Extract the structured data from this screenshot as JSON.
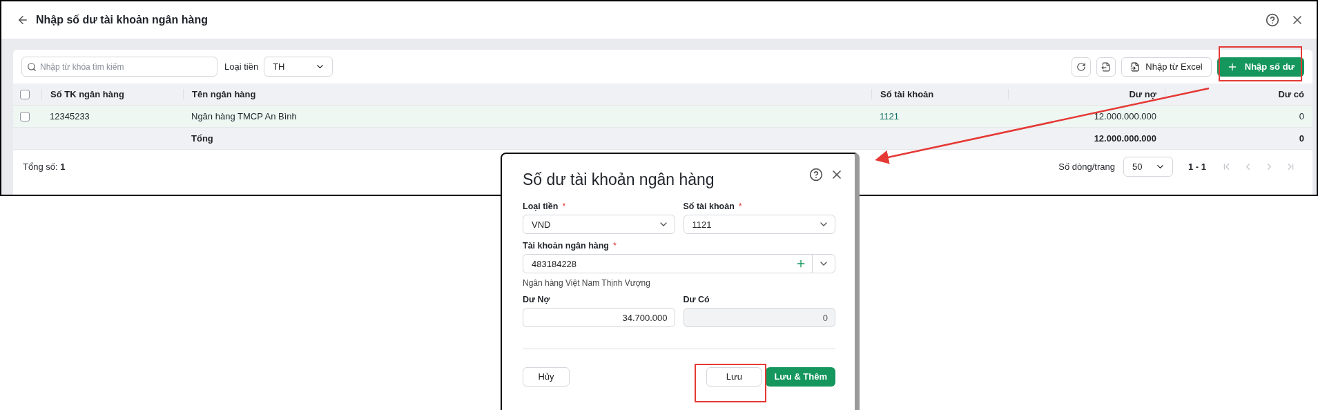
{
  "page": {
    "title": "Nhập số dư tài khoản ngân hàng"
  },
  "toolbar": {
    "search_placeholder": "Nhập từ khóa tìm kiếm",
    "currency_label": "Loại tiền",
    "currency_value": "TH",
    "import_label": "Nhập từ Excel",
    "add_label": "Nhập số dư"
  },
  "table": {
    "header_checked": false,
    "columns": [
      {
        "label": "Số TK ngân hàng",
        "kind": "text"
      },
      {
        "label": "Tên ngân hàng",
        "kind": "text"
      },
      {
        "label": "Số tài khoản",
        "kind": "link"
      },
      {
        "label": "Dư nợ",
        "kind": "amount"
      },
      {
        "label": "Dư có",
        "kind": "amount"
      }
    ],
    "rows": [
      {
        "checked": false,
        "cells": [
          "12345233",
          "Ngân hàng TMCP An Bình",
          "1121",
          "12.000.000.000",
          "0"
        ]
      }
    ],
    "total": {
      "label": "Tổng",
      "debit": "12.000.000.000",
      "credit": "0"
    }
  },
  "footer": {
    "count": "Tổng số: **1**",
    "page_size_label": "Số dòng/trang",
    "page_size": "50",
    "range": "1 - 1",
    "pager": [
      {
        "kind": "first",
        "disabled": true
      },
      {
        "kind": "prev",
        "disabled": true
      },
      {
        "kind": "next",
        "disabled": true
      },
      {
        "kind": "last",
        "disabled": true
      }
    ]
  },
  "dialog": {
    "title": "Số dư tài khoản ngân hàng",
    "fields": [
      {
        "kind": "select",
        "label": "Loại tiền",
        "required_mark": "*",
        "value": "VND",
        "wide": false
      },
      {
        "kind": "select",
        "label": "Số tài khoản",
        "required_mark": "*",
        "value": "1121",
        "wide": false
      },
      {
        "kind": "combo",
        "label": "Tài khoản ngân hàng",
        "required_mark": "*",
        "value": "483184228",
        "wide": true,
        "hint": "Ngân hàng Việt Nam Thịnh Vượng"
      },
      {
        "kind": "number",
        "label": "Dư Nợ",
        "value": "34.700.000",
        "wide": false,
        "disabled": false
      },
      {
        "kind": "number",
        "label": "Dư Có",
        "value": "0",
        "wide": false,
        "disabled": true
      }
    ],
    "cancel": "Hủy",
    "save": "Lưu",
    "save_add": "Lưu & Thêm"
  }
}
